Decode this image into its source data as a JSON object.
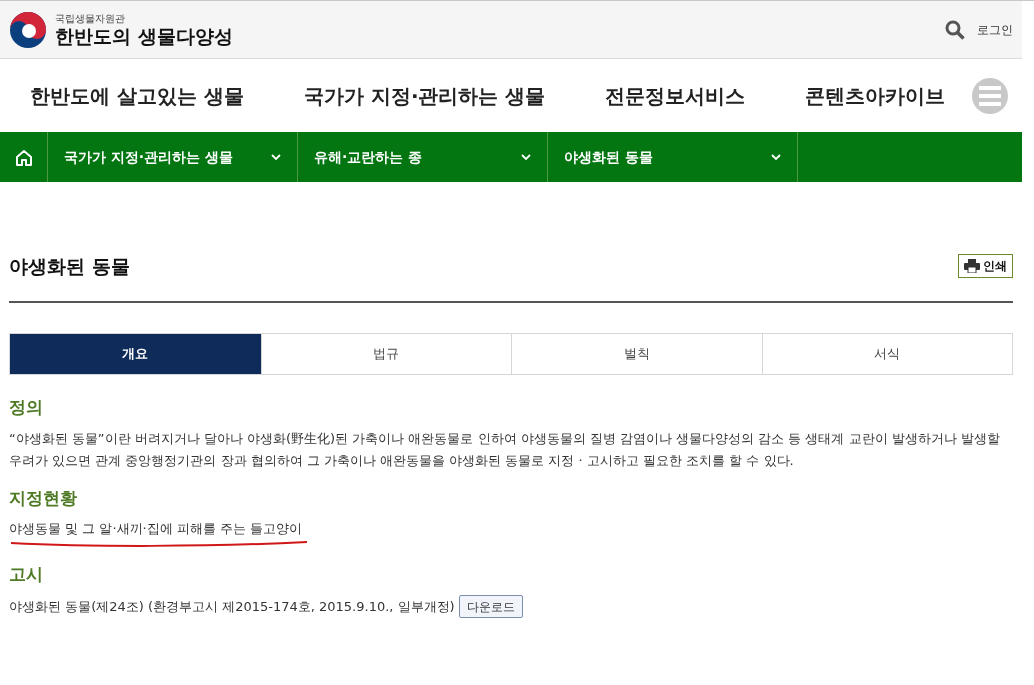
{
  "header": {
    "org": "국립생물자원관",
    "site_title": "한반도의 생물다양성",
    "login": "로그인"
  },
  "main_nav": [
    "한반도에 살고있는 생물",
    "국가가 지정·관리하는 생물",
    "전문정보서비스",
    "콘텐츠아카이브"
  ],
  "breadcrumb": [
    {
      "label": "국가가 지정·관리하는 생물"
    },
    {
      "label": "유해·교란하는 종"
    },
    {
      "label": "야생화된 동물"
    }
  ],
  "page_title": "야생화된 동물",
  "print_button": "인쇄",
  "tabs": [
    {
      "label": "개요",
      "selected": true
    },
    {
      "label": "법규",
      "selected": false
    },
    {
      "label": "벌칙",
      "selected": false
    },
    {
      "label": "서식",
      "selected": false
    }
  ],
  "sections": [
    {
      "heading": "정의",
      "kind": "text",
      "text": "“야생화된 동물”이란 버려지거나 달아나 야생화(野生化)된 가축이나 애완동물로 인하여 야생동물의 질병 감염이나 생물다양성의 감소 등 생태계 교란이 발생하거나 발생할 우려가 있으면 관계 중앙행정기관의 장과 협의하여 그 가축이나 애완동물을 야생화된 동물로 지정 · 고시하고 필요한 조치를 할 수 있다."
    },
    {
      "heading": "지정현황",
      "kind": "underlined",
      "text": "야생동물 및 그 알·새끼·집에 피해를 주는 들고양이"
    },
    {
      "heading": "고시",
      "kind": "download",
      "text": "야생화된 동물(제24조) (환경부고시 제2015-174호, 2015.9.10., 일부개정)",
      "button": "다운로드"
    }
  ]
}
